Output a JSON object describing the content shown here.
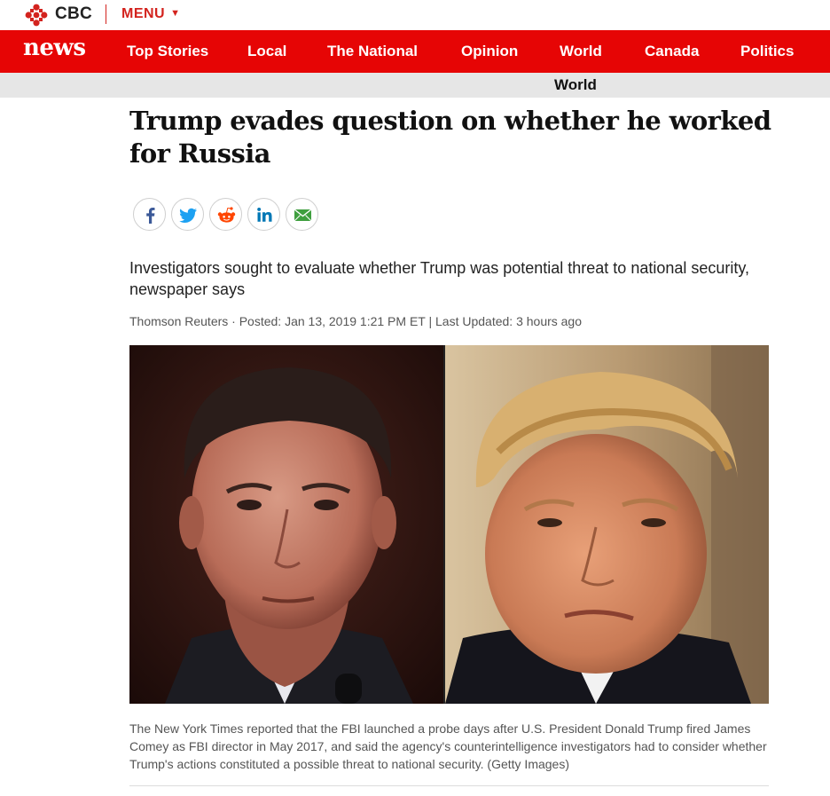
{
  "header": {
    "brand": "CBC",
    "menu_label": "MENU"
  },
  "nav": {
    "logo": "news",
    "items": [
      {
        "label": "Top Stories"
      },
      {
        "label": "Local"
      },
      {
        "label": "The National"
      },
      {
        "label": "Opinion"
      },
      {
        "label": "World"
      },
      {
        "label": "Canada"
      },
      {
        "label": "Politics"
      }
    ]
  },
  "section": {
    "label": "World"
  },
  "article": {
    "headline": "Trump evades question on whether he worked for Russia",
    "deck": "Investigators sought to evaluate whether Trump was potential threat to national security, newspaper says",
    "byline": "Thomson Reuters · Posted: Jan 13, 2019 1:21 PM ET | Last Updated: 3 hours ago",
    "caption": "The New York Times reported that the FBI launched a probe days after U.S. President Donald Trump fired James Comey as FBI director in May 2017, and said the agency's counterintelligence investigators had to consider whether Trump's actions constituted a possible threat to national security. (Getty Images)"
  },
  "share_icons": [
    {
      "icon": "facebook-icon",
      "color": "#3b5998"
    },
    {
      "icon": "twitter-icon",
      "color": "#1da1f2"
    },
    {
      "icon": "reddit-icon",
      "color": "#ff4500"
    },
    {
      "icon": "linkedin-icon",
      "color": "#0077b5"
    },
    {
      "icon": "email-icon",
      "color": "#3f9f3f"
    }
  ],
  "colors": {
    "brand_red": "#e60505",
    "menu_red": "#d3231e",
    "subbar_gray": "#e6e6e6"
  }
}
